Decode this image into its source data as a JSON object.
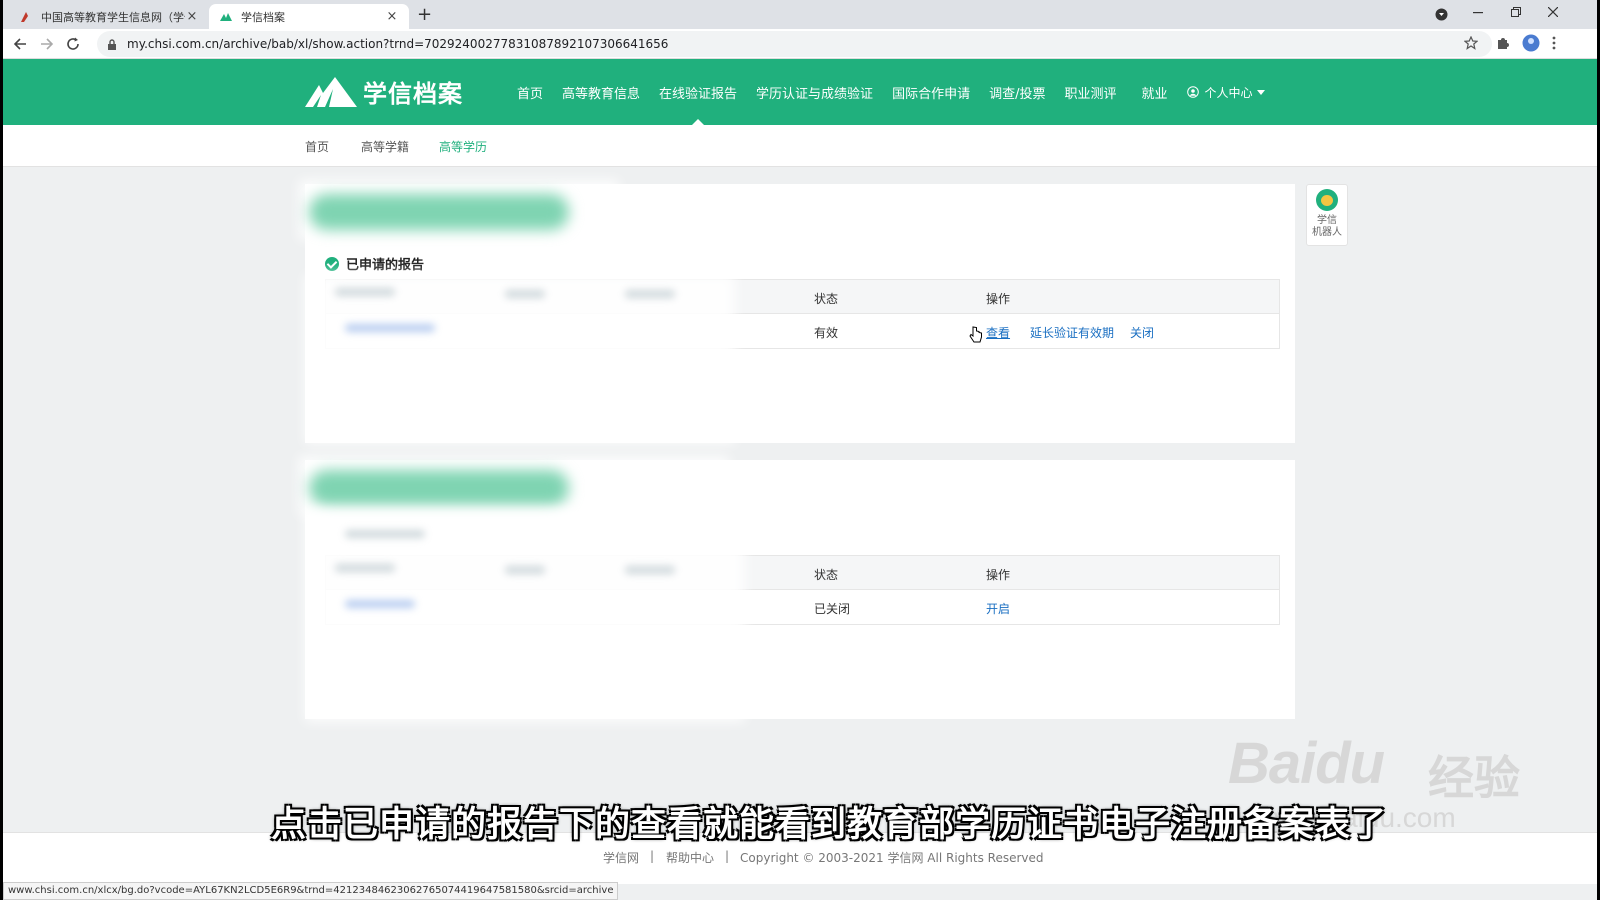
{
  "browser": {
    "tabs": [
      {
        "title": "中国高等教育学生信息网（学信网",
        "active": false
      },
      {
        "title": "学信档案",
        "active": true
      }
    ],
    "new_tab": "+",
    "close_glyph": "×",
    "url": "my.chsi.com.cn/archive/bab/xl/show.action?trnd=70292400277831087892107306641656",
    "status_url": "www.chsi.com.cn/xlcx/bg.do?vcode=AYL67KN2LCD5E6R9&trnd=42123484623062765074419647581580&srcid=archive"
  },
  "header": {
    "logo_text": "学信档案",
    "nav": [
      "首页",
      "高等教育信息",
      "在线验证报告",
      "学历认证与成绩验证",
      "国际合作申请",
      "调查/投票",
      "职业测评",
      "就业"
    ],
    "active_nav": "在线验证报告",
    "personal_center": "个人中心"
  },
  "subnav": {
    "items": [
      "首页",
      "高等学籍",
      "高等学历"
    ],
    "current": "高等学历"
  },
  "card1": {
    "section_title": "已申请的报告",
    "headers": {
      "status": "状态",
      "action": "操作"
    },
    "row": {
      "status": "有效",
      "view": "查看",
      "extend": "延长验证有效期",
      "close": "关闭"
    }
  },
  "card2": {
    "headers": {
      "status": "状态",
      "action": "操作"
    },
    "row": {
      "status": "已关闭",
      "open": "开启"
    }
  },
  "robot": {
    "label1": "学信",
    "label2": "机器人"
  },
  "footer": {
    "site": "学信网",
    "sep": "|",
    "help": "帮助中心",
    "copyright": "Copyright © 2003-2021 学信网 All Rights Reserved"
  },
  "overlay": {
    "subtitle": "点击已申请的报告下的查看就能看到教育部学历证书电子注册备案表了",
    "watermark_brand": "Baidu",
    "watermark_cn": "经验",
    "watermark_url": "jingyan.baidu.com"
  },
  "colors": {
    "brand_green": "#20b07d",
    "link_blue": "#1a6fc2"
  }
}
